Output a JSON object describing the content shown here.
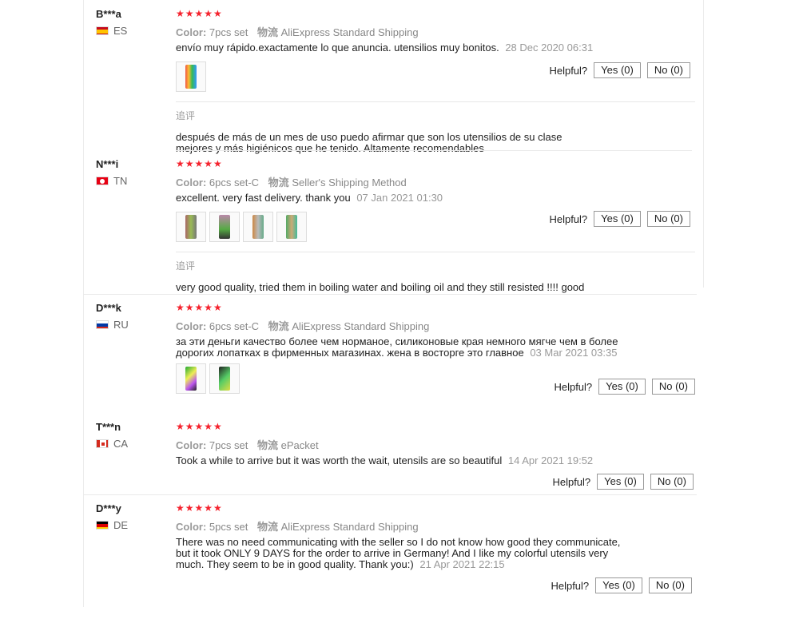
{
  "labels": {
    "color": "Color:",
    "shipping": "物流",
    "helpful": "Helpful?",
    "followup": "追评"
  },
  "reviews": [
    {
      "user": "B***a",
      "country": "ES",
      "stars": "★★★★★",
      "color_value": "7pcs set",
      "shipping_value": "AliExpress Standard Shipping",
      "content": "envío muy rápido.exactamente lo que anuncia. utensilios muy bonitos.",
      "date": "28 Dec 2020 06:31",
      "yes": "Yes (0)",
      "no": "No (0)",
      "followup": "después de más de un mes de uso puedo afirmar que son los utensilios de su clase mejores y más higiénicos que he tenido. Altamente recomendables"
    },
    {
      "user": "N***i",
      "country": "TN",
      "stars": "★★★★★",
      "color_value": "6pcs set-C",
      "shipping_value": "Seller's Shipping Method",
      "content": "excellent. very fast delivery. thank you",
      "date": "07 Jan 2021 01:30",
      "yes": "Yes (0)",
      "no": "No (0)",
      "followup": "very good quality, tried them in boiling water and boiling oil and they still resisted !!!! good"
    },
    {
      "user": "D***k",
      "country": "RU",
      "stars": "★★★★★",
      "color_value": "6pcs set-C",
      "shipping_value": "AliExpress Standard Shipping",
      "content": "за эти деньги качество более чем норманое, силиконовые края немного мягче чем в более дорогих лопатках в фирменных магазинах. жена в восторге это главное",
      "date": "03 Mar 2021 03:35",
      "yes": "Yes (0)",
      "no": "No (0)"
    },
    {
      "user": "T***n",
      "country": "CA",
      "stars": "★★★★★",
      "color_value": "7pcs set",
      "shipping_value": "ePacket",
      "content": "Took a while to arrive but it was worth the wait, utensils are so beautiful",
      "date": "14 Apr 2021 19:52",
      "yes": "Yes (0)",
      "no": "No (0)"
    },
    {
      "user": "D***y",
      "country": "DE",
      "stars": "★★★★★",
      "color_value": "5pcs set",
      "shipping_value": "AliExpress Standard Shipping",
      "content": "There was no need communicating with the seller so I do not know how good they communicate, but it took ONLY 9 DAYS for the order to arrive in Germany! And I like my colorful utensils very much. They seem to be in good quality. Thank you:)",
      "date": "21 Apr 2021 22:15",
      "yes": "Yes (0)",
      "no": "No (0)"
    }
  ],
  "colors": {
    "star": "#f5222d",
    "muted": "#999999",
    "text": "#222222"
  }
}
